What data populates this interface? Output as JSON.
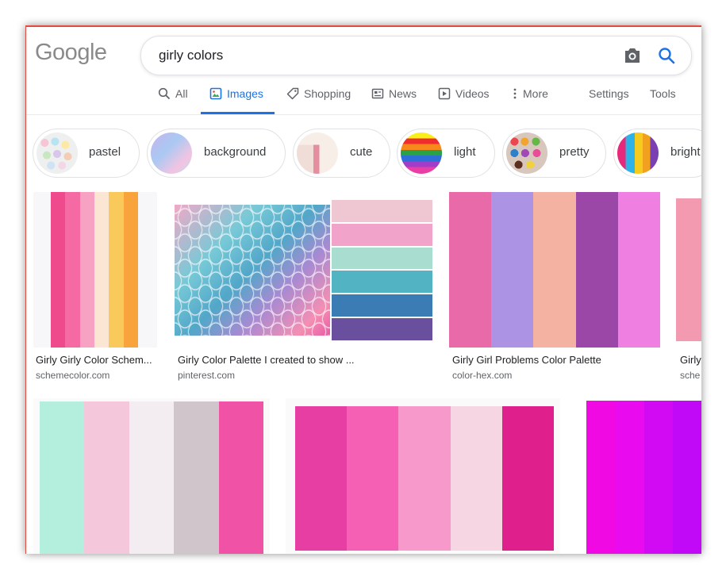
{
  "header": {
    "logo": "Google"
  },
  "search": {
    "query": "girly colors"
  },
  "tabs": [
    {
      "label": "All",
      "icon": "search-icon"
    },
    {
      "label": "Images",
      "icon": "image-icon",
      "active": true
    },
    {
      "label": "Shopping",
      "icon": "tag-icon"
    },
    {
      "label": "News",
      "icon": "news-icon"
    },
    {
      "label": "Videos",
      "icon": "play-icon"
    },
    {
      "label": "More",
      "icon": "more-vert-icon"
    },
    {
      "label": "Settings"
    },
    {
      "label": "Tools"
    }
  ],
  "chips": [
    {
      "label": "pastel"
    },
    {
      "label": "background"
    },
    {
      "label": "cute"
    },
    {
      "label": "light"
    },
    {
      "label": "pretty"
    },
    {
      "label": "bright"
    }
  ],
  "results": [
    {
      "title": "Girly Girly Color Schem...",
      "source": "schemecolor.com",
      "colors": [
        "#ee4a8c",
        "#f56aa3",
        "#f7a1c3",
        "#fbe6d3",
        "#fac95c",
        "#f8a33b"
      ]
    },
    {
      "title": "Girly Color Palette I created to show ...",
      "source": "pinterest.com",
      "colors": [
        "#efc7d3",
        "#f2a3c9",
        "#a9ddd0",
        "#52b4c2",
        "#3a7cb3",
        "#6a4f9e"
      ]
    },
    {
      "title": "Girly Girl Problems Color Palette",
      "source": "color-hex.com",
      "colors": [
        "#e86aa8",
        "#ad93e3",
        "#f4b2a2",
        "#9a47a7",
        "#f07fe2"
      ]
    },
    {
      "title": "Girly",
      "source": "sche",
      "colors": [
        "#f39ab0"
      ]
    },
    {
      "title": "",
      "source": "",
      "colors": [
        "#b4efde",
        "#f5c7da",
        "#f3edf2",
        "#d0c5ca",
        "#f053a6"
      ]
    },
    {
      "title": "",
      "source": "",
      "colors": [
        "#e63ea3",
        "#f560b4",
        "#f79acb",
        "#f7d6e3",
        "#de1f8c"
      ]
    },
    {
      "title": "",
      "source": "",
      "colors": [
        "#f109e3",
        "#e90af0",
        "#d20af4",
        "#c108f7"
      ]
    }
  ],
  "colors": {
    "accent": "#1a73e8",
    "tab_text": "#5f6368",
    "border_red": "#e04a3f"
  }
}
